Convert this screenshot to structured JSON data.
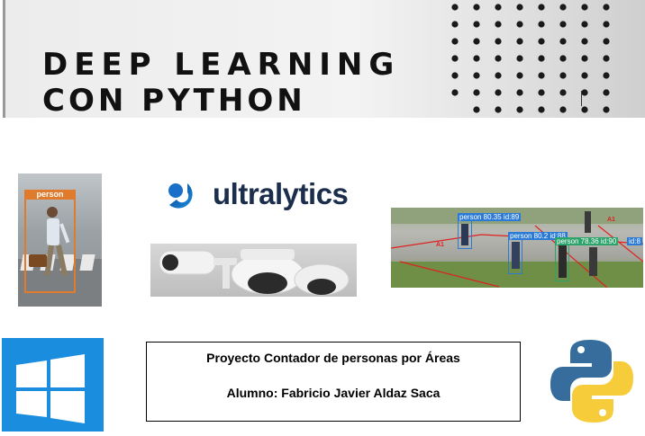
{
  "banner": {
    "line1": "DEEP LEARNING",
    "line2": "CON PYTHON"
  },
  "walker": {
    "detection_label": "person"
  },
  "ultralytics": {
    "logo_text": "ultralytics",
    "color_dark": "#1b2e4c",
    "color_accent": "#1a73c8"
  },
  "detection_image": {
    "labels": [
      "person 80.35 id:89",
      "person 80.2 id:88",
      "person 78.36 id:90",
      "id:8"
    ],
    "area_labels": [
      "A1",
      "A1"
    ]
  },
  "info_box": {
    "project_line": "Proyecto Contador de personas por Áreas",
    "student_line": "Alumno: Fabricio Javier Aldaz Saca"
  },
  "colors": {
    "windows_blue": "#1b8dde",
    "python_blue": "#366d9c",
    "python_yellow": "#f7cc3b",
    "detection_orange": "#e07a2c"
  }
}
